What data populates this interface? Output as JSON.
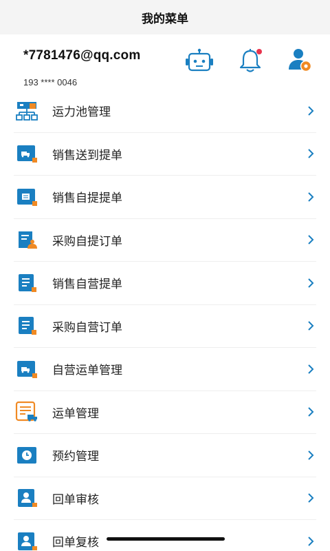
{
  "nav": {
    "title": "我的菜单"
  },
  "profile": {
    "email": "*7781476@qq.com",
    "phone": "193 **** 0046"
  },
  "colors": {
    "accent": "#1a7fc1",
    "orange": "#f08a24",
    "badge": "#e8344e",
    "chevron": "#1a7fc1"
  },
  "menu": [
    {
      "label": "运力池管理",
      "icon": "org-chart-icon"
    },
    {
      "label": "销售送到提单",
      "icon": "truck-card-icon"
    },
    {
      "label": "销售自提提单",
      "icon": "doc-card-icon"
    },
    {
      "label": "采购自提订单",
      "icon": "doc-person-icon"
    },
    {
      "label": "销售自营提单",
      "icon": "list-doc-icon"
    },
    {
      "label": "采购自营订单",
      "icon": "list-doc-icon"
    },
    {
      "label": "自营运单管理",
      "icon": "truck-card-icon"
    },
    {
      "label": "运单管理",
      "icon": "waybill-icon"
    },
    {
      "label": "预约管理",
      "icon": "clock-card-icon"
    },
    {
      "label": "回单审核",
      "icon": "person-card-icon"
    },
    {
      "label": "回单复核",
      "icon": "person-card-icon"
    }
  ]
}
